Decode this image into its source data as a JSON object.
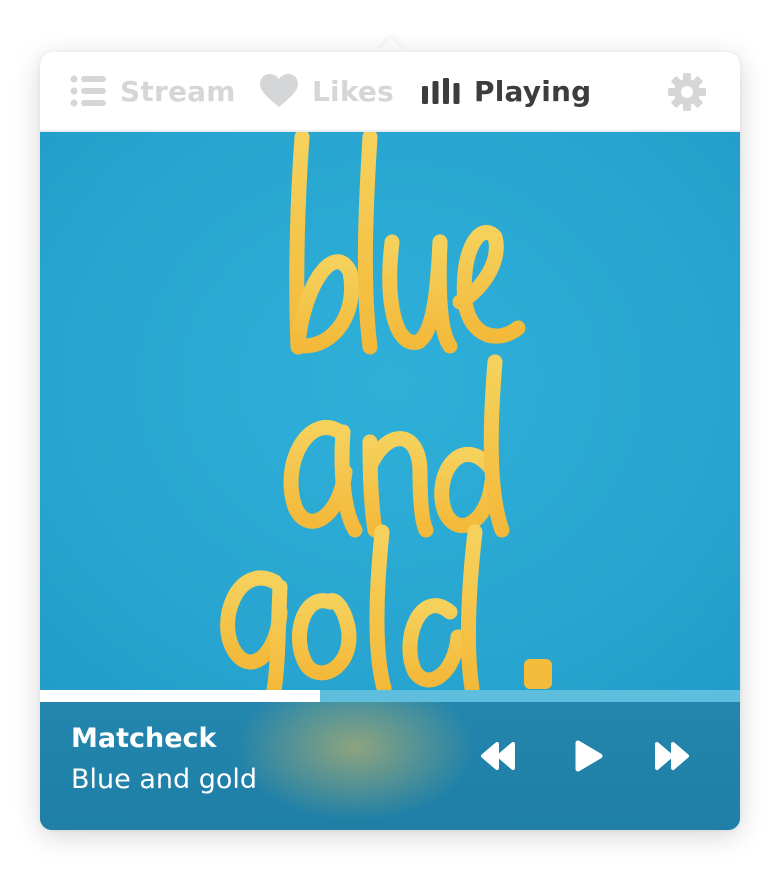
{
  "tabs": [
    {
      "label": "Stream",
      "icon": "list-icon",
      "active": false
    },
    {
      "label": "Likes",
      "icon": "heart-icon",
      "active": false
    },
    {
      "label": "Playing",
      "icon": "bars-icon",
      "active": true
    }
  ],
  "settings_icon": "gear-icon",
  "artwork": {
    "lettering": "blue and gold.",
    "background_color": "#2aa9d2",
    "lettering_color": "#f5c545"
  },
  "now_playing": {
    "artist": "Matcheck",
    "track": "Blue and gold",
    "progress": 0.4
  },
  "controls": {
    "previous_icon": "rewind-icon",
    "play_icon": "play-icon",
    "next_icon": "fast-forward-icon"
  },
  "colors": {
    "active_tab": "#3d3d3d",
    "inactive_tab": "#d4d6d8",
    "footer": "#2184ab"
  }
}
